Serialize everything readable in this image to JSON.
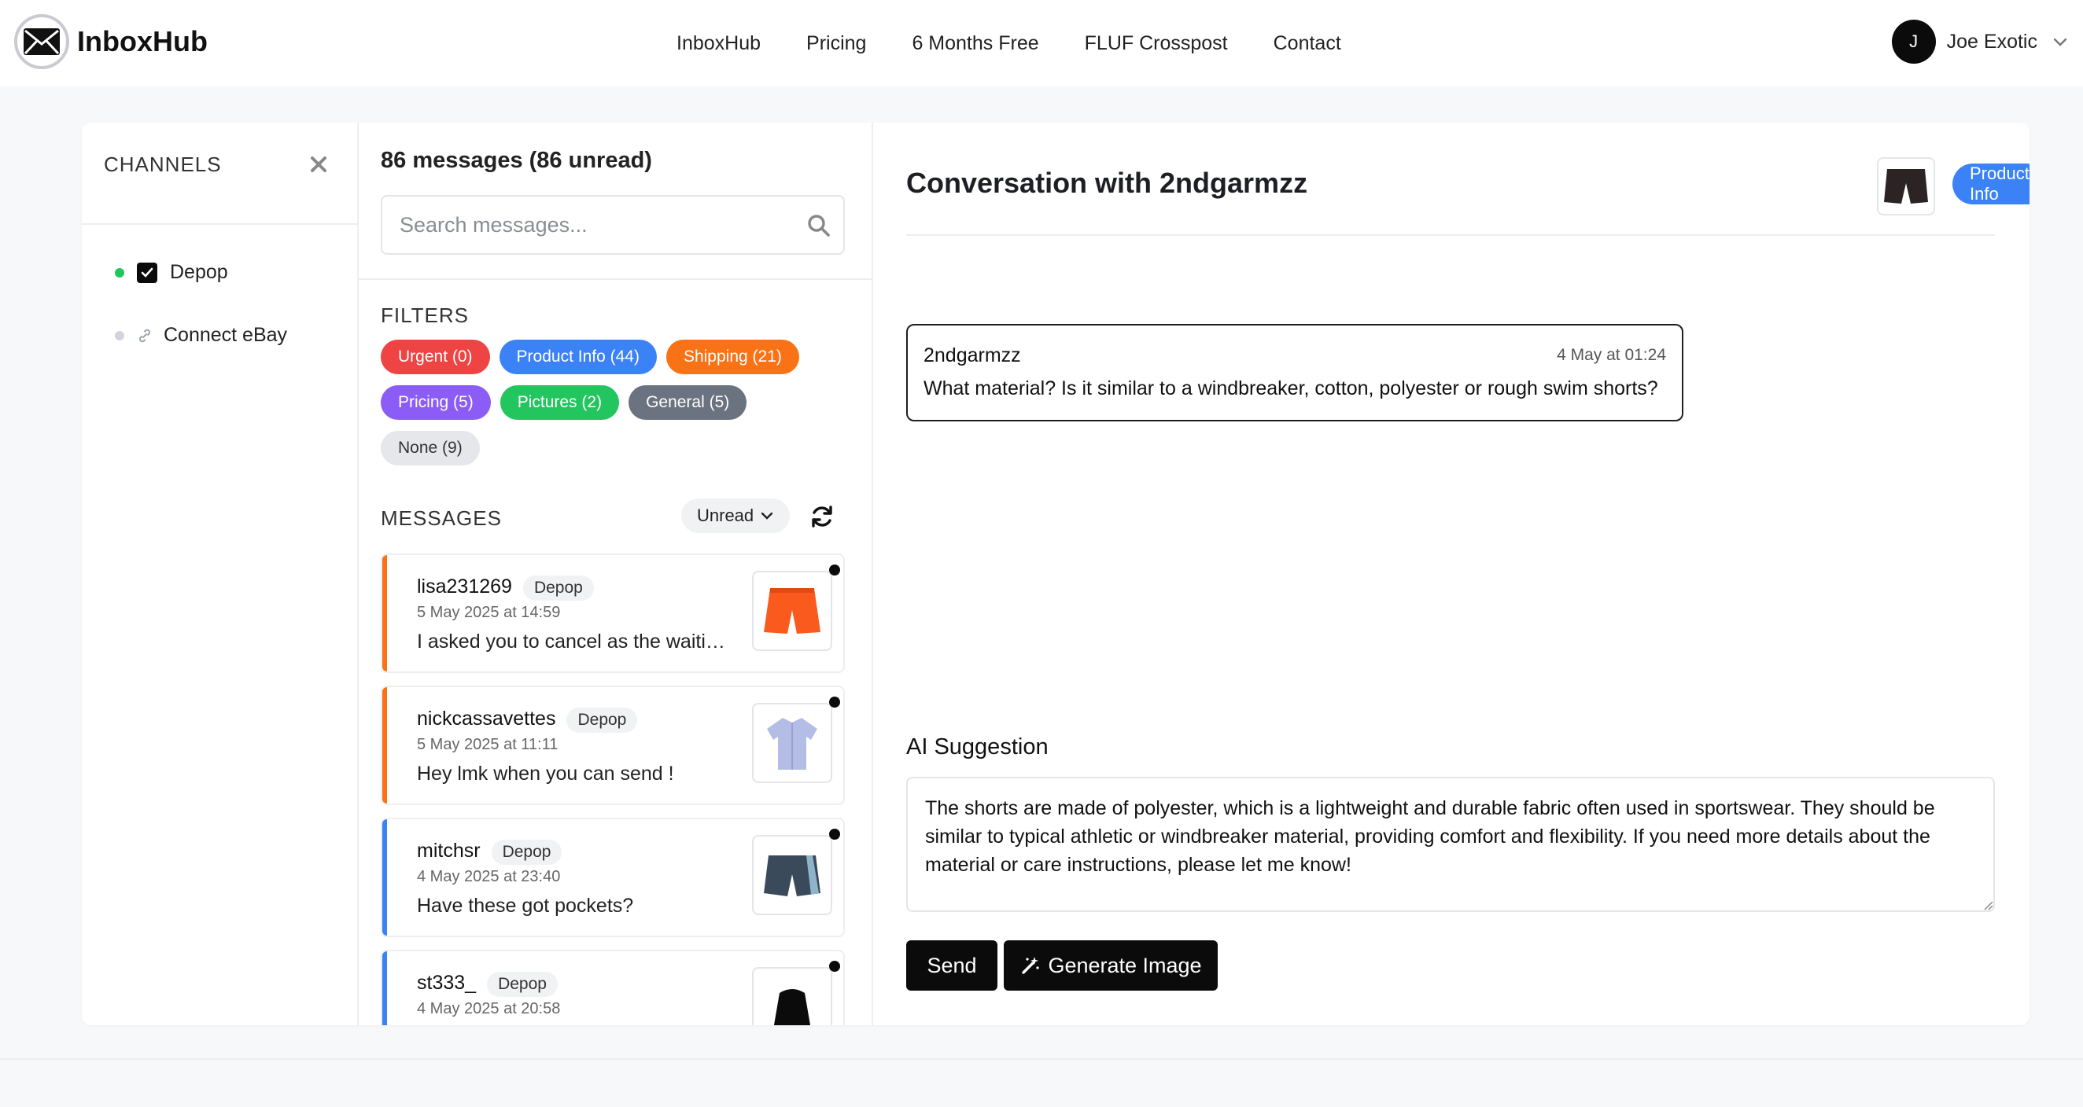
{
  "brand": {
    "name": "InboxHub"
  },
  "nav": {
    "links": [
      "InboxHub",
      "Pricing",
      "6 Months Free",
      "FLUF Crosspost",
      "Contact"
    ]
  },
  "user": {
    "initial": "J",
    "name": "Joe Exotic"
  },
  "channels": {
    "title": "CHANNELS",
    "items": [
      {
        "label": "Depop",
        "status_color": "#22c55e",
        "checked": true
      },
      {
        "label": "Connect eBay",
        "status_color": "#d1d5db"
      }
    ]
  },
  "inbox": {
    "count_label": "86 messages (86 unread)",
    "search_placeholder": "Search messages...",
    "filters_title": "FILTERS",
    "filters": [
      {
        "label": "Urgent (0)",
        "color": "#ef4444",
        "text_color": "#ffffff"
      },
      {
        "label": "Product Info (44)",
        "color": "#3b82f6",
        "text_color": "#ffffff"
      },
      {
        "label": "Shipping (21)",
        "color": "#f97316",
        "text_color": "#ffffff"
      },
      {
        "label": "Pricing (5)",
        "color": "#8b5cf6",
        "text_color": "#ffffff"
      },
      {
        "label": "Pictures (2)",
        "color": "#22c55e",
        "text_color": "#ffffff"
      },
      {
        "label": "General (5)",
        "color": "#6b7280",
        "text_color": "#ffffff"
      },
      {
        "label": "None (9)",
        "color": "#e5e7eb",
        "text_color": "#333333"
      }
    ],
    "messages_title": "MESSAGES",
    "sort_label": "Unread",
    "messages": [
      {
        "user": "lisa231269",
        "tag": "Depop",
        "date": "5 May 2025 at 14:59",
        "text": "I asked you to cancel as the waiting time was too long",
        "bar_color": "#f97316",
        "thumb": "orange-shorts-icon"
      },
      {
        "user": "nickcassavettes",
        "tag": "Depop",
        "date": "5 May 2025 at 11:11",
        "text": "Hey lmk when you can send !",
        "bar_color": "#f97316",
        "thumb": "shirt-icon"
      },
      {
        "user": "mitchsr",
        "tag": "Depop",
        "date": "4 May 2025 at 23:40",
        "text": "Have these got pockets?",
        "bar_color": "#3b82f6",
        "thumb": "swim-shorts-icon"
      },
      {
        "user": "st333_",
        "tag": "Depop",
        "date": "4 May 2025 at 20:58",
        "text": "",
        "bar_color": "#3b82f6",
        "thumb": "black-top-icon"
      }
    ]
  },
  "conversation": {
    "title": "Conversation with 2ndgarmzz",
    "tag": "Product Info",
    "message": {
      "user": "2ndgarmzz",
      "time": "4 May at 01:24",
      "text": "What material? Is it similar to a windbreaker, cotton, polyester or rough swim shorts?"
    },
    "ai_title": "AI Suggestion",
    "ai_text": "The shorts are made of polyester, which is a lightweight and durable fabric often used in sportswear. They should be similar to typical athletic or windbreaker material, providing comfort and flexibility. If you need more details about the material or care instructions, please let me know!",
    "send_label": "Send",
    "generate_label": "Generate Image"
  }
}
